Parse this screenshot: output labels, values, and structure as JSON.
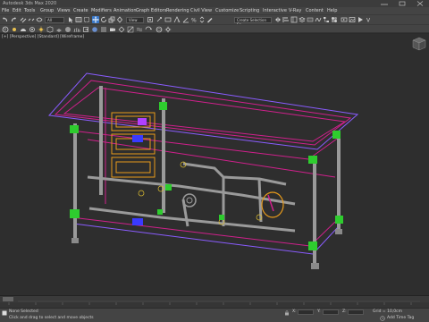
{
  "app": {
    "title": "Autodesk 3ds Max 2020"
  },
  "menu": {
    "items": [
      "File",
      "Edit",
      "Tools",
      "Group",
      "Views",
      "Create",
      "Modifiers",
      "Animation",
      "Graph Editors",
      "Rendering",
      "Civil View",
      "Customize",
      "Scripting",
      "Interactive",
      "V-Ray",
      "Content",
      "Help"
    ]
  },
  "toolbar": {
    "selection_filter": "All",
    "view_dropdown": "View",
    "named_selection_set": "Create Selection Se"
  },
  "viewport": {
    "label": "[+] [Perspective] [Standard] [Wireframe]"
  },
  "status": {
    "selection": "None Selected",
    "prompt": "Click and drag to select and move objects",
    "x_label": "X:",
    "y_label": "Y:",
    "z_label": "Z:",
    "grid": "Grid = 10,0cm",
    "add_time_tag": "Add Time Tag"
  },
  "colors": {
    "accent": "#3a78c8",
    "frame_magenta": "#d0208c",
    "frame_purple": "#8a5cff",
    "pipe_gray": "#8c8c8c",
    "fitting_green": "#2ecc2e",
    "valve_blue": "#3a3aff",
    "panel_orange": "#e89b1a"
  }
}
